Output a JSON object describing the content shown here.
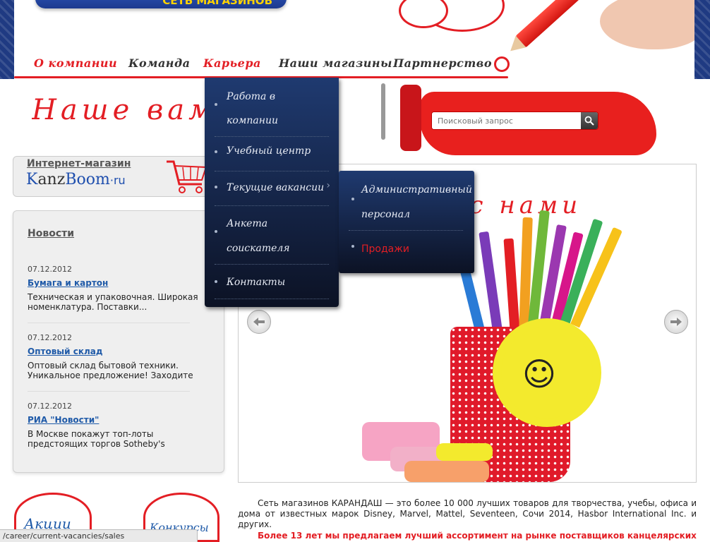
{
  "header": {
    "banner_text": "СЕТЬ МАГАЗИНОВ",
    "nav": [
      {
        "label": "О компании"
      },
      {
        "label": "Команда"
      },
      {
        "label": "Карьера"
      },
      {
        "label": "Наши магазины"
      },
      {
        "label": "Партнерство"
      }
    ]
  },
  "slogan": "Наше вам с кисточкой",
  "search": {
    "placeholder": "Поисковый запрос"
  },
  "shop": {
    "title": "Интернет-магазин",
    "logo_k": "K",
    "logo_anz": "anz",
    "logo_boom": "Boom",
    "logo_ru": "·ru"
  },
  "news": {
    "heading": "Новости",
    "items": [
      {
        "date": "07.12.2012",
        "title": "Бумага и картон",
        "text": "Техническая и упаковочная. Широкая номенклатура. Поставки..."
      },
      {
        "date": "07.12.2012",
        "title": "Оптовый склад",
        "text": "Оптовый склад бытовой техники. Уникальное предложение! Заходите"
      },
      {
        "date": "07.12.2012",
        "title": "РИА \"Новости\"",
        "text": "В Москве покажут топ-лоты предстоящих торгов Sotheby's"
      }
    ]
  },
  "bottom": {
    "left_label": "Акции",
    "right_label": "Конкурсы"
  },
  "slider": {
    "title": "Вместе с нами"
  },
  "caption": "Сеть магазинов КАРАНДАШ — это более 10 000 лучших товаров для  творчества, учебы, офиса и дома  от известных марок Disney, Marvel, Mattel, Seventeen, Сочи 2014, Hasbor International Inc. и других.",
  "caption2": "Более  13 лет  мы  предлагаем лучший ассортимент  на рынке  поставщиков  канцелярских",
  "dropdown": {
    "items": [
      {
        "line1": "Работа в",
        "line2": "компании"
      },
      {
        "line1": "Учебный центр"
      },
      {
        "line1": "Текущие вакансии"
      },
      {
        "line1": "Анкета",
        "line2": "соискателя"
      },
      {
        "line1": "Контакты"
      }
    ],
    "submenu": [
      {
        "line1": "Административный",
        "line2": "персонал"
      },
      {
        "line1": "Продажи"
      }
    ]
  },
  "status_url": "/career/current-vacancies/sales",
  "colors": {
    "brand_red": "#e31e24",
    "menu_navy": "#1f3a70",
    "link_blue": "#1f5aa8"
  }
}
